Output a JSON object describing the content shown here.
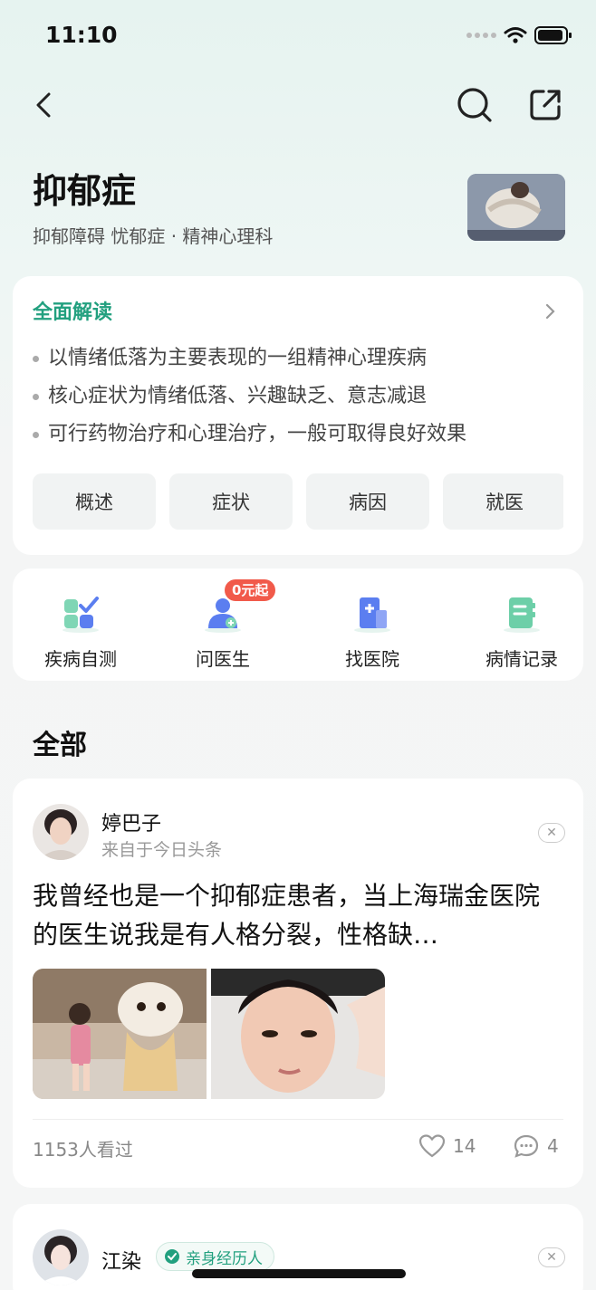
{
  "status_bar": {
    "time": "11:10"
  },
  "header": {
    "title": "抑郁症",
    "subtitle": "抑郁障碍  忧郁症 · 精神心理科"
  },
  "overview_card": {
    "title": "全面解读",
    "points": [
      "以情绪低落为主要表现的一组精神心理疾病",
      "核心症状为情绪低落、兴趣缺乏、意志减退",
      "可行药物治疗和心理治疗，一般可取得良好效果"
    ],
    "tabs": [
      "概述",
      "症状",
      "病因",
      "就医"
    ]
  },
  "services": {
    "items": [
      {
        "label": "疾病自测",
        "icon": "self-test-icon"
      },
      {
        "label": "问医生",
        "icon": "ask-doctor-icon"
      },
      {
        "label": "找医院",
        "icon": "hospital-icon"
      },
      {
        "label": "病情记录",
        "icon": "record-icon"
      }
    ],
    "promo_badge": "0元起"
  },
  "feed": {
    "section_title": "全部",
    "posts": [
      {
        "author": "婷巴子",
        "source": "来自于今日头条",
        "text": "我曾经也是一个抑郁症患者，当上海瑞金医院的医生说我是有人格分裂，性格缺…",
        "views": "1153人看过",
        "likes": "14",
        "comments": "4"
      },
      {
        "author": "江染",
        "badge": "亲身经历人"
      }
    ]
  },
  "colors": {
    "accent": "#22a07f",
    "promo": "#f15a4a",
    "service_green": "#6dcfa8",
    "service_blue": "#5b7ef0"
  }
}
